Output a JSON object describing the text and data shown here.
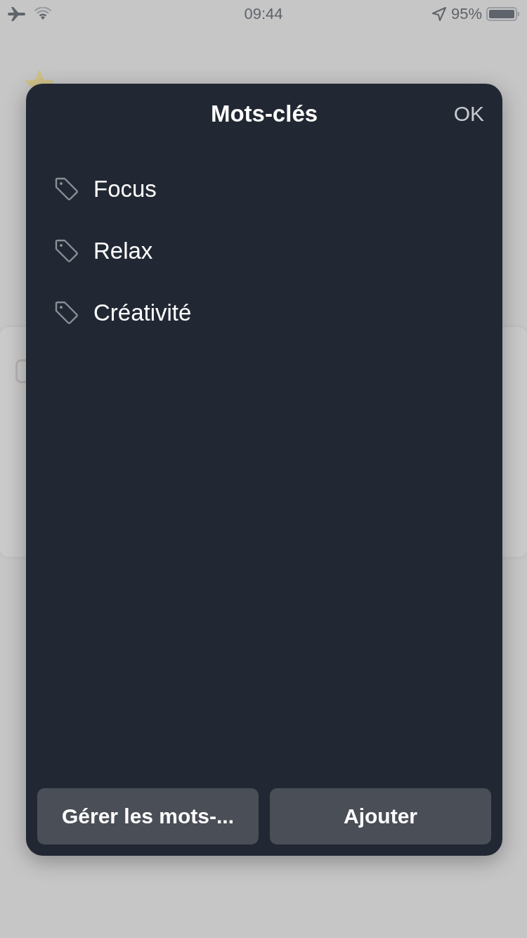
{
  "status_bar": {
    "time": "09:44",
    "battery": "95%"
  },
  "sheet": {
    "title": "Mots-clés",
    "confirm": "OK",
    "tags": [
      {
        "label": "Focus"
      },
      {
        "label": "Relax"
      },
      {
        "label": "Créativité"
      }
    ],
    "buttons": [
      {
        "label": "Gérer les mots-..."
      },
      {
        "label": "Ajouter"
      }
    ]
  }
}
